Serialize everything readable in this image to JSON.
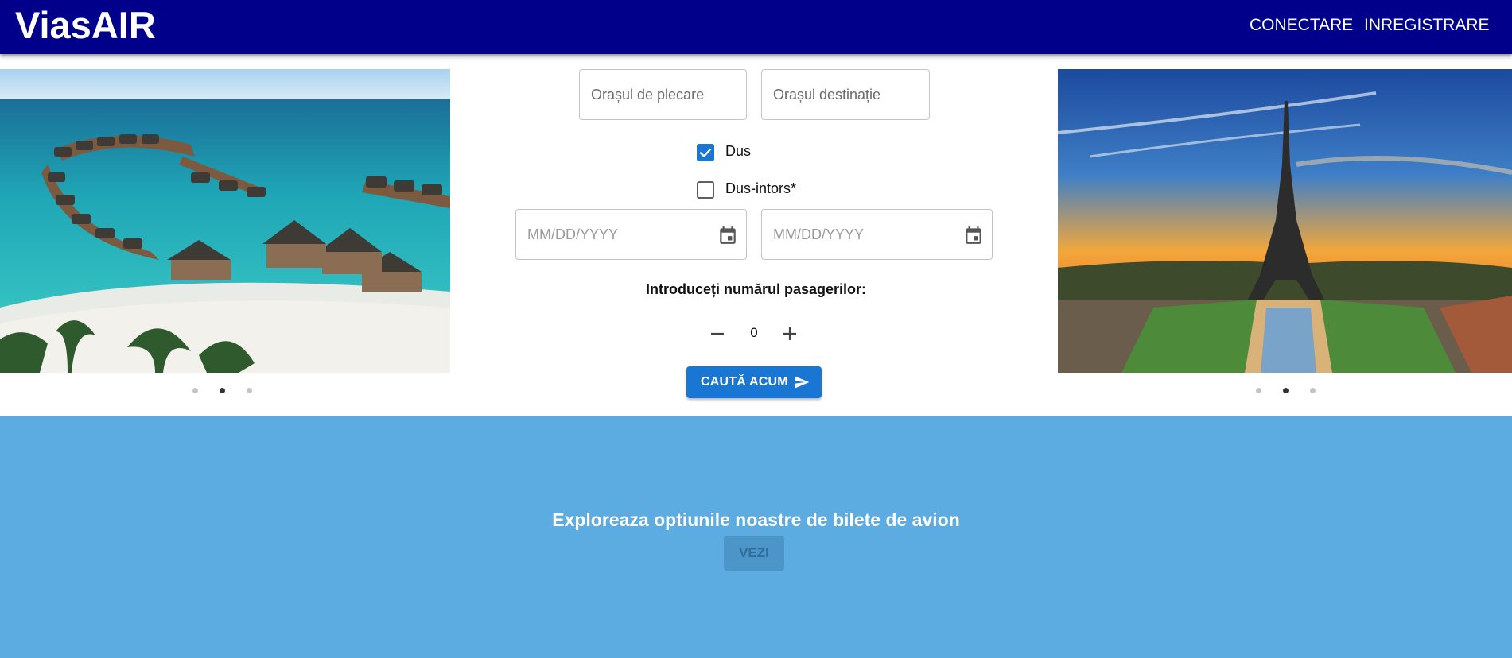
{
  "header": {
    "logo": "ViasAIR",
    "nav": {
      "login": "CONECTARE",
      "register": "INREGISTRARE"
    },
    "bg_color": "#00008b"
  },
  "carousels": {
    "left": {
      "image": "maldives-overwater-villas-photo",
      "active_dot": 2,
      "dot_count": 3
    },
    "right": {
      "image": "eiffel-tower-sunset-photo",
      "active_dot": 2,
      "dot_count": 3
    }
  },
  "search": {
    "departure_placeholder": "Orașul de plecare",
    "destination_placeholder": "Orașul destinație",
    "one_way": {
      "label": "Dus",
      "checked": true
    },
    "round_trip": {
      "label": "Dus-intors*",
      "checked": false
    },
    "depart_date_placeholder": "MM/DD/YYYY",
    "return_date_placeholder": "MM/DD/YYYY",
    "passengers_label": "Introduceți numărul pasagerilor:",
    "passengers_value": "0",
    "submit_label": "CAUTĂ ACUM",
    "accent_color": "#1976d2"
  },
  "explore": {
    "title": "Exploreaza optiunile noastre de bilete de avion",
    "button_label": "VEZI",
    "bg_color": "#5cace2"
  },
  "icons": [
    "calendar-icon",
    "minus-icon",
    "plus-icon",
    "send-icon",
    "check-icon"
  ]
}
